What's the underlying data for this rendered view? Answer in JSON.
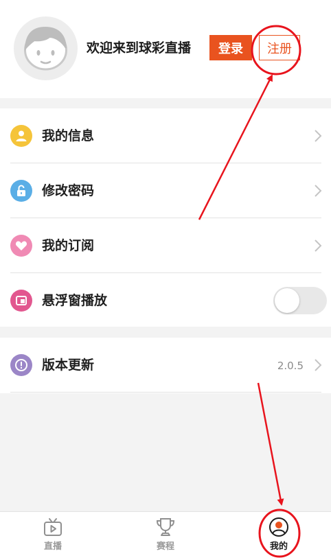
{
  "header": {
    "welcome": "欢迎来到球彩直播",
    "login_label": "登录",
    "register_label": "注册"
  },
  "menu": {
    "items": [
      {
        "label": "我的信息",
        "icon": "user-icon",
        "color": "#f5c43a"
      },
      {
        "label": "修改密码",
        "icon": "lock-icon",
        "color": "#5aaee6"
      },
      {
        "label": "我的订阅",
        "icon": "heart-icon",
        "color": "#f08ab4"
      },
      {
        "label": "悬浮窗播放",
        "icon": "float-window-icon",
        "color": "#e2578f",
        "toggle": false
      }
    ],
    "version_item": {
      "label": "版本更新",
      "icon": "exclamation-icon",
      "color": "#9b86c7",
      "value": "2.0.5"
    }
  },
  "tabbar": {
    "tabs": [
      {
        "label": "直播",
        "icon": "tv-icon"
      },
      {
        "label": "赛程",
        "icon": "trophy-icon"
      },
      {
        "label": "我的",
        "icon": "profile-icon",
        "active": true
      }
    ]
  },
  "colors": {
    "accent": "#e9531f",
    "annotation": "#e8141d"
  }
}
